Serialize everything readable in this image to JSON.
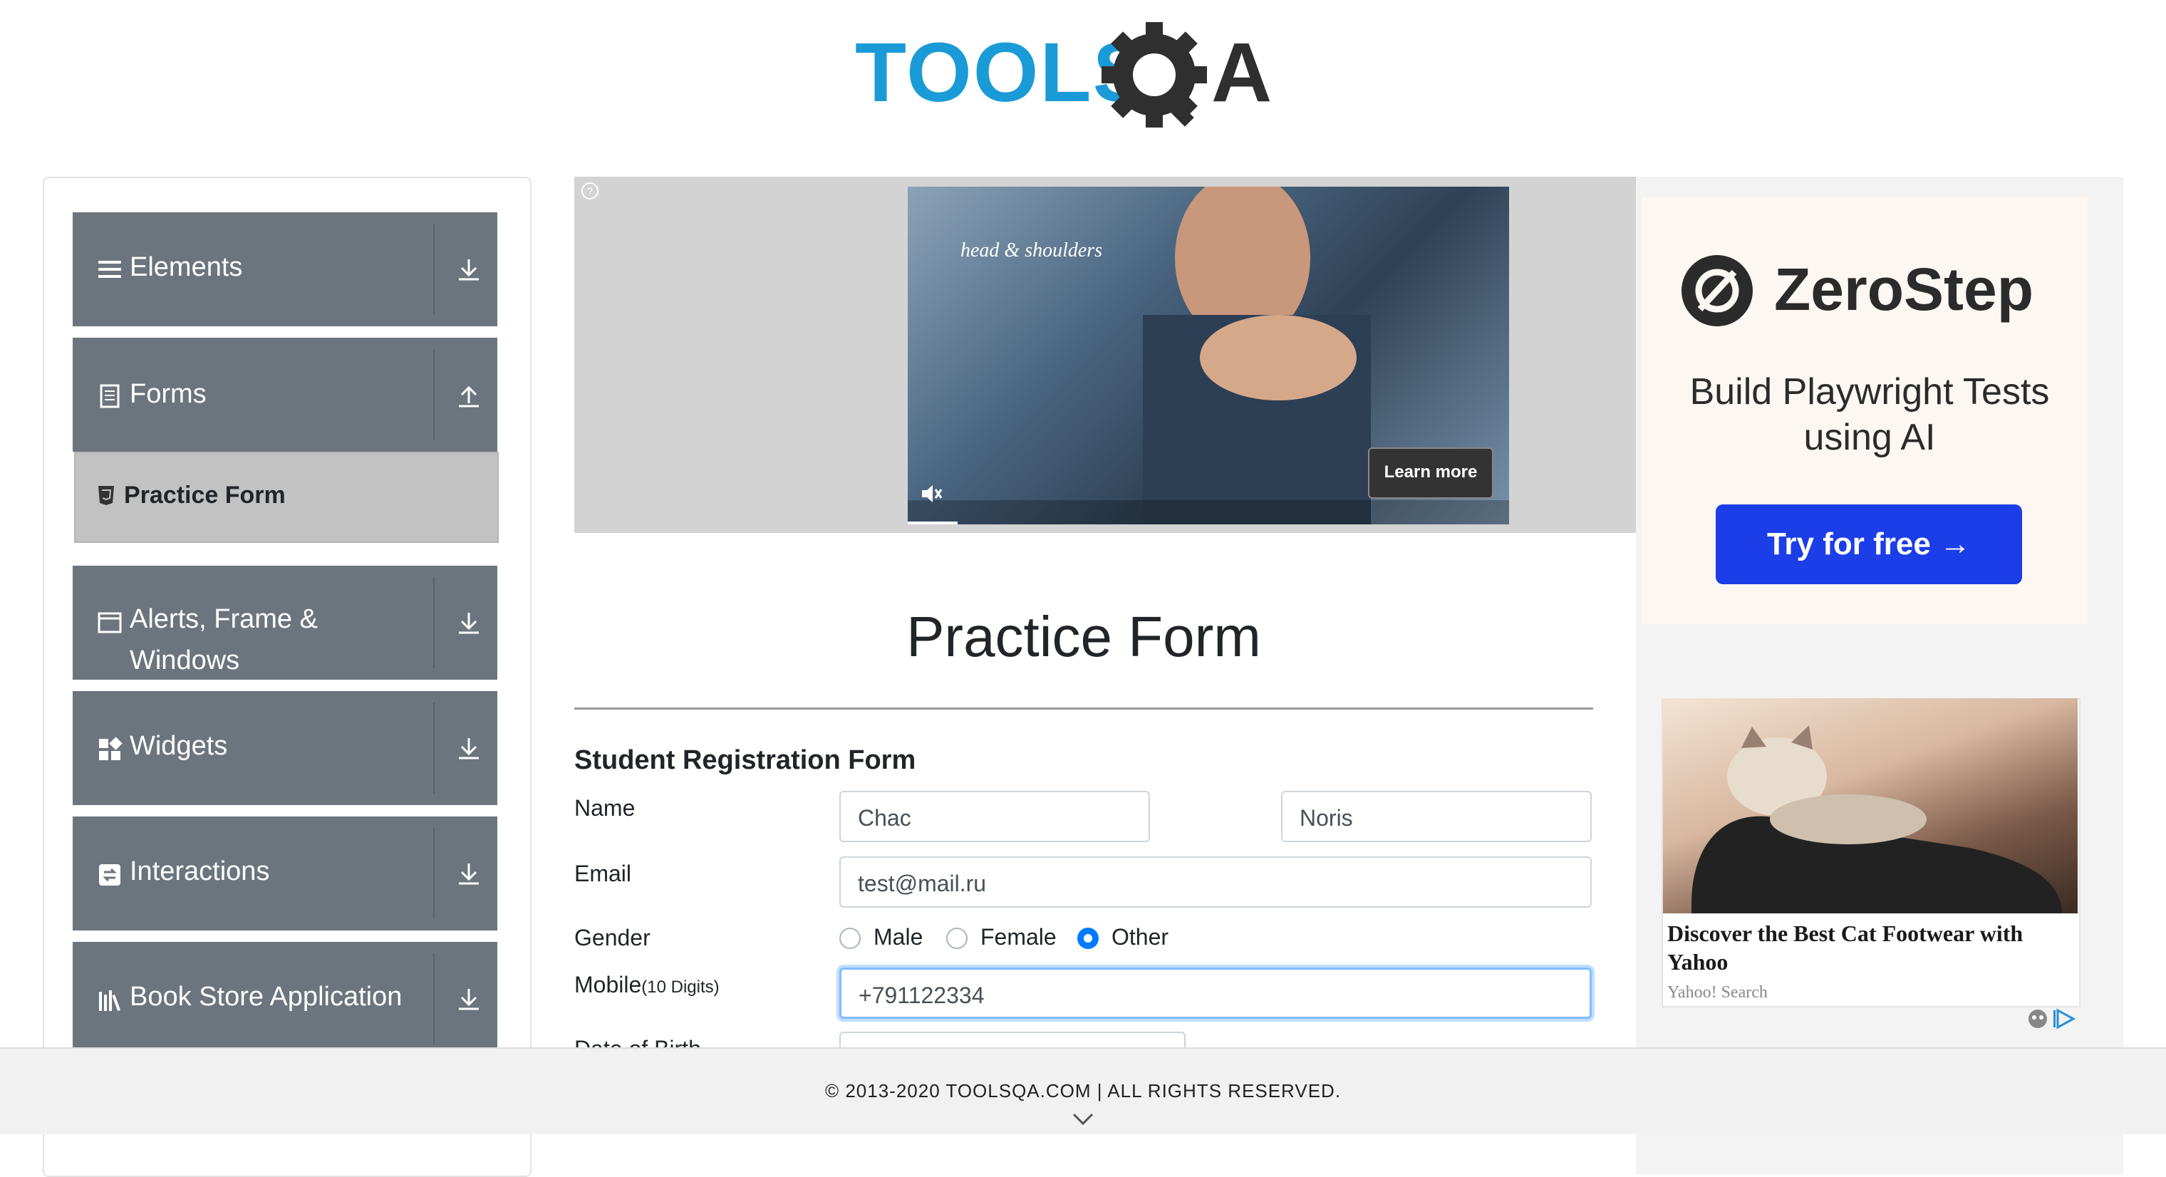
{
  "logo": {
    "text_blue": "TOOLS",
    "text_gray": "A"
  },
  "sidebar": {
    "groups": [
      {
        "label": "Elements",
        "icon": "list-icon",
        "arrow": "download-arrow-icon"
      },
      {
        "label": "Forms",
        "icon": "document-icon",
        "arrow": "upload-arrow-icon"
      },
      {
        "label": "Alerts, Frame &",
        "label2": "Windows",
        "icon": "window-icon",
        "arrow": "download-arrow-icon"
      },
      {
        "label": "Widgets",
        "icon": "widgets-icon",
        "arrow": "download-arrow-icon"
      },
      {
        "label": "Interactions",
        "icon": "interactions-icon",
        "arrow": "download-arrow-icon"
      },
      {
        "label": "Book Store Application",
        "icon": "books-icon",
        "arrow": "download-arrow-icon"
      }
    ],
    "active_item": {
      "label": "Practice Form",
      "icon": "html5-icon"
    }
  },
  "ad_banner": {
    "brand": "head & shoulders",
    "learn_more": "Learn more",
    "info_icon": "help-circle-icon",
    "mute_icon": "muted-speaker-icon"
  },
  "right_ads": {
    "zerostep": {
      "title": "ZeroStep",
      "subtitle": "Build Playwright Tests using AI",
      "button": "Try for free →"
    },
    "cat_ad": {
      "title": "Discover the Best Cat Footwear with Yahoo",
      "source": "Yahoo! Search"
    }
  },
  "page": {
    "title": "Practice Form"
  },
  "form": {
    "title": "Student Registration Form",
    "name_label": "Name",
    "first_name": "Chac",
    "last_name": "Noris",
    "email_label": "Email",
    "email": "test@mail.ru",
    "gender_label": "Gender",
    "gender_options": [
      "Male",
      "Female",
      "Other"
    ],
    "gender_selected": "Other",
    "mobile_label": "Mobile",
    "mobile_hint": "(10 Digits)",
    "mobile": "+791122334",
    "dob_label": "Date of Birth"
  },
  "footer": {
    "text": "© 2013-2020 TOOLSQA.COM | ALL RIGHTS RESERVED."
  },
  "colors": {
    "sidebar_bg": "#6c757d",
    "accent": "#007bff",
    "logo_blue": "#1a9bd7",
    "logo_gray": "#2f2f2f"
  }
}
